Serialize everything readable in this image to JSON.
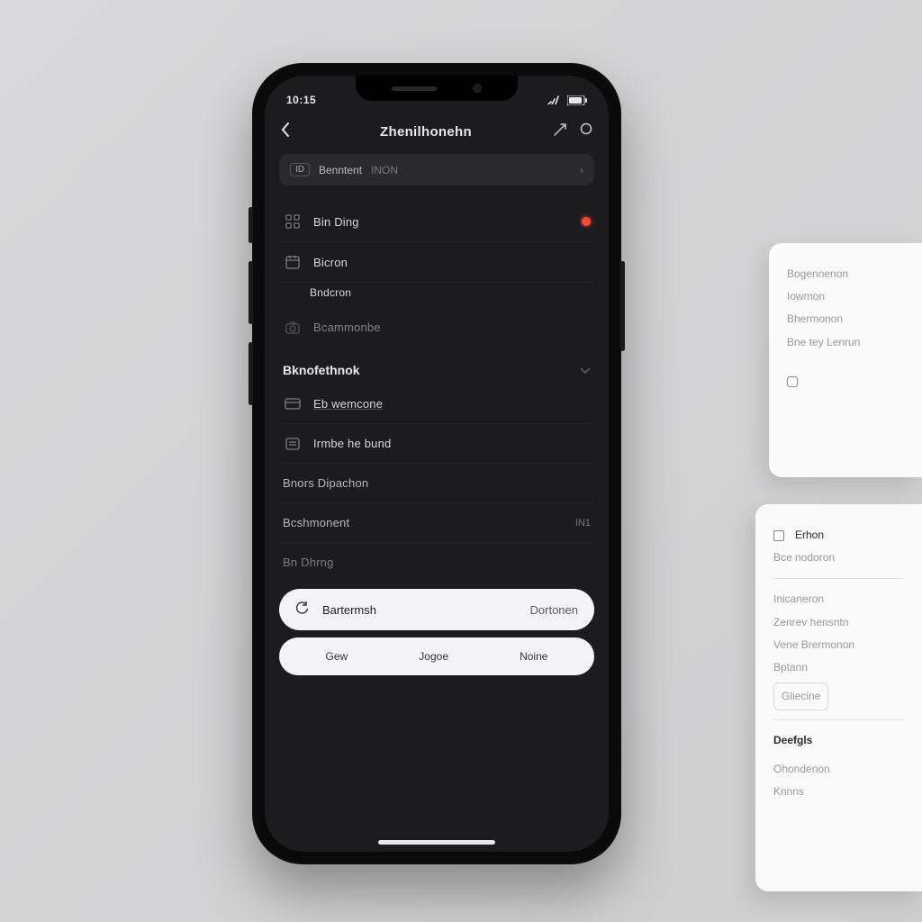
{
  "statusbar": {
    "time": "10:15"
  },
  "nav": {
    "title": "Zhenilhonehn"
  },
  "segment": {
    "badge": "ID",
    "label1": "Benntent",
    "label2": "INON"
  },
  "list1": [
    {
      "icon": "grid",
      "label": "Bin Ding",
      "trail_type": "dot"
    },
    {
      "icon": "calendar",
      "label": "Bicron",
      "trail_type": "none"
    },
    {
      "icon": "",
      "label": "Bndcron",
      "sub": true
    },
    {
      "icon": "camera",
      "label": "Bcammonbe",
      "sub": false,
      "trail_type": "none",
      "muted": true
    }
  ],
  "section": {
    "title": "Bknofethnok"
  },
  "list2": [
    {
      "icon": "card",
      "label": "Eb wemcone",
      "underline": true
    },
    {
      "icon": "list",
      "label": "Irmbe he bund"
    },
    {
      "icon": "",
      "label": "Bnors Dipachon",
      "plain": true
    },
    {
      "icon": "",
      "label": "Bcshmonent",
      "plain": true,
      "trail": "IN1"
    },
    {
      "icon": "",
      "label": "Bn Dhrng",
      "plain": true,
      "muted": true
    }
  ],
  "pill_primary": {
    "icon": "refresh",
    "label": "Bartermsh",
    "secondary": "Dortonen"
  },
  "pill_secondary": {
    "a": "Gew",
    "b": "Jogoe",
    "c": "Noine"
  },
  "card1": {
    "lines": [
      "Bogennenon",
      "Iowmon",
      "Bhermonon",
      "Bne tey Lenrun"
    ]
  },
  "card2": {
    "header": "Erhon",
    "header_sub": "Bce nodoron",
    "lines": [
      "Inicaneron",
      "Zenrev hensntn",
      "Vene Brermonon",
      "Bptann",
      "Gliecine"
    ],
    "footer_title": "Deefgls",
    "footer_lines": [
      "Ohondenon",
      "Knnns"
    ]
  }
}
